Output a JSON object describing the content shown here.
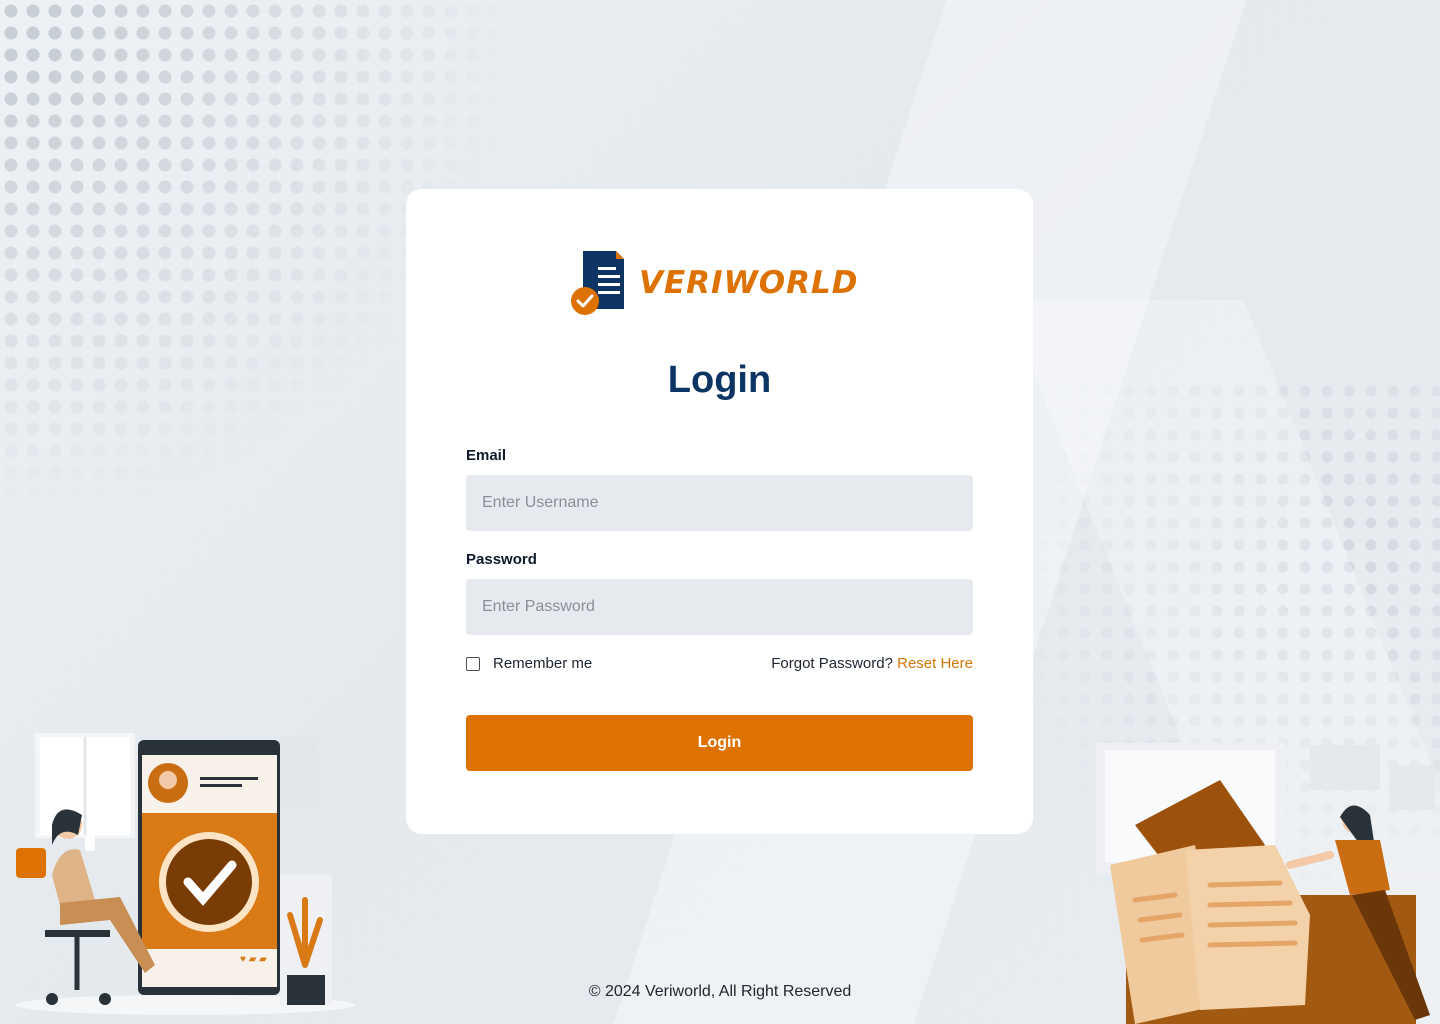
{
  "brand": {
    "name": "VERIWORLD",
    "accent_color": "#dd7200",
    "primary_color": "#0c3563"
  },
  "login": {
    "title": "Login",
    "email_label": "Email",
    "email_placeholder": "Enter Username",
    "password_label": "Password",
    "password_placeholder": "Enter Password",
    "remember_label": "Remember me",
    "forgot_text": "Forgot Password?",
    "reset_link": "Reset Here",
    "submit_label": "Login"
  },
  "footer": {
    "copyright": "© 2024 Veriworld, All Right Reserved"
  },
  "icons": {
    "logo": "document-check-icon",
    "left_illustration": "verified-profile-illustration",
    "right_illustration": "documents-mail-illustration"
  }
}
